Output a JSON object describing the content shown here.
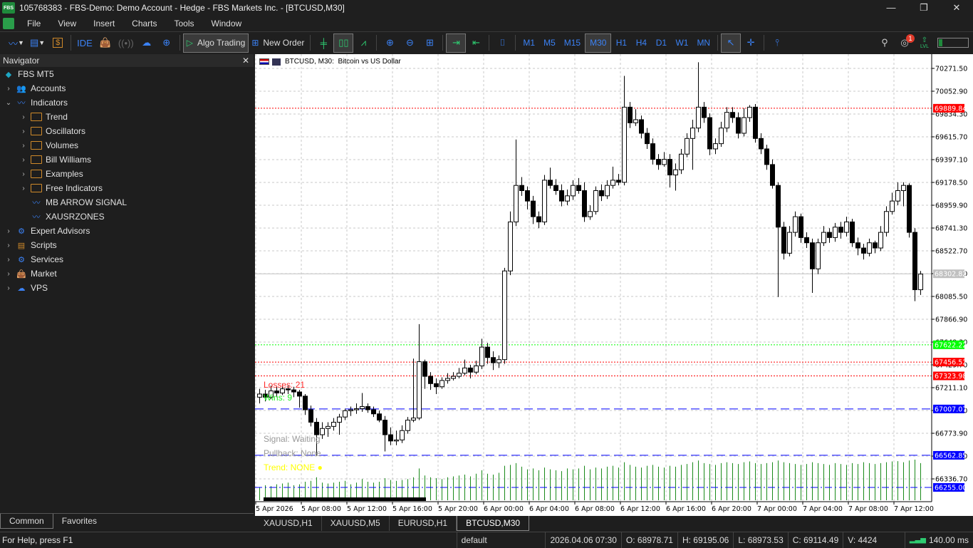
{
  "window": {
    "title": "105768383 - FBS-Demo: Demo Account - Hedge - FBS Markets Inc. - [BTCUSD,M30]",
    "logo_text": "FBS",
    "minimize": "—",
    "restore": "❐",
    "close": "✕"
  },
  "menu": [
    "File",
    "View",
    "Insert",
    "Charts",
    "Tools",
    "Window"
  ],
  "toolbar": {
    "ide": "IDE",
    "algo_trading": "Algo Trading",
    "new_order": "New Order",
    "timeframes": [
      "M1",
      "M5",
      "M15",
      "M30",
      "H1",
      "H4",
      "D1",
      "W1",
      "MN"
    ],
    "selected_timeframe": "M30",
    "notification_count": "1",
    "lvl": "LVL"
  },
  "navigator": {
    "title": "Navigator",
    "close": "✕",
    "root": "FBS MT5",
    "items": [
      {
        "label": "Accounts",
        "level": 0,
        "expander": "›",
        "icon": "accounts-icon"
      },
      {
        "label": "Indicators",
        "level": 0,
        "expander": "⌄",
        "icon": "indicators-icon"
      },
      {
        "label": "Trend",
        "level": 1,
        "expander": "›",
        "icon": "folder-icon"
      },
      {
        "label": "Oscillators",
        "level": 1,
        "expander": "›",
        "icon": "folder-icon"
      },
      {
        "label": "Volumes",
        "level": 1,
        "expander": "›",
        "icon": "folder-icon"
      },
      {
        "label": "Bill Williams",
        "level": 1,
        "expander": "›",
        "icon": "folder-icon"
      },
      {
        "label": "Examples",
        "level": 1,
        "expander": "›",
        "icon": "folder-icon"
      },
      {
        "label": "Free Indicators",
        "level": 1,
        "expander": "›",
        "icon": "folder-icon"
      },
      {
        "label": "MB ARROW SIGNAL",
        "level": 1,
        "expander": "",
        "icon": "indicator-icon"
      },
      {
        "label": "XAUSRZONES",
        "level": 1,
        "expander": "",
        "icon": "indicator-icon"
      },
      {
        "label": "Expert Advisors",
        "level": 0,
        "expander": "›",
        "icon": "experts-icon"
      },
      {
        "label": "Scripts",
        "level": 0,
        "expander": "›",
        "icon": "scripts-icon"
      },
      {
        "label": "Services",
        "level": 0,
        "expander": "›",
        "icon": "services-icon"
      },
      {
        "label": "Market",
        "level": 0,
        "expander": "›",
        "icon": "market-icon"
      },
      {
        "label": "VPS",
        "level": 0,
        "expander": "›",
        "icon": "vps-icon"
      }
    ],
    "tabs": [
      "Common",
      "Favorites"
    ],
    "active_tab": "Common"
  },
  "symbol_tabs": [
    "XAUUSD,H1",
    "XAUUSD,M5",
    "EURUSD,H1",
    "BTCUSD,M30"
  ],
  "active_symbol_tab": "BTCUSD,M30",
  "status": {
    "help": "For Help, press F1",
    "profile": "default",
    "datetime": "2026.04.06 07:30",
    "open": "O: 68978.71",
    "high": "H: 69195.06",
    "low": "L: 68973.53",
    "close": "C: 69114.49",
    "volume": "V: 4424",
    "ping": "140.00 ms"
  },
  "overlay": {
    "losses": "Losses: 21",
    "wins": "Wins: 9",
    "signal": "Signal: Waiting",
    "pullback": "Pullback: None",
    "trend": "Trend: NONE ●"
  },
  "colors": {
    "up": "#ffffff",
    "down": "#000000",
    "volume": "#1a8a1a",
    "losses": "#ff2a2a",
    "wins": "#22ee22",
    "signal": "#999999",
    "trend": "#ffff00",
    "accent": "#3b82f6"
  },
  "chart_data": {
    "type": "candlestick",
    "title": "BTCUSD, M30:  Bitcoin vs US Dollar",
    "symbol": "BTCUSD",
    "timeframe": "M30",
    "ylim": [
      66220,
      70330
    ],
    "y_ticks": [
      "70271.50",
      "70052.90",
      "69834.30",
      "69615.70",
      "69397.10",
      "69178.50",
      "68959.90",
      "68741.30",
      "68522.70",
      "68304.10",
      "68085.50",
      "67866.90",
      "67648.30",
      "67429.70",
      "67211.10",
      "66992.50",
      "66773.90",
      "66555.30",
      "66336.70"
    ],
    "x_labels": [
      "5 Apr 2026",
      "5 Apr 08:00",
      "5 Apr 12:00",
      "5 Apr 16:00",
      "5 Apr 20:00",
      "6 Apr 00:00",
      "6 Apr 04:00",
      "6 Apr 08:00",
      "6 Apr 12:00",
      "6 Apr 16:00",
      "6 Apr 20:00",
      "7 Apr 00:00",
      "7 Apr 04:00",
      "7 Apr 08:00",
      "7 Apr 12:00"
    ],
    "levels": [
      {
        "price": 69889.84,
        "label": "69889.84",
        "color": "#ff0000",
        "style": "dotted"
      },
      {
        "price": 68302.82,
        "label": "68302.82",
        "color": "#c0c0c0",
        "style": "solid"
      },
      {
        "price": 67622.22,
        "label": "67622.22",
        "color": "#00ff00",
        "style": "dotted"
      },
      {
        "price": 67456.52,
        "label": "67456.52",
        "color": "#ff0000",
        "style": "dotted"
      },
      {
        "price": 67323.98,
        "label": "67323.98",
        "color": "#ff0000",
        "style": "dotted"
      },
      {
        "price": 67007.07,
        "label": "67007.07",
        "color": "#0000ff",
        "style": "dashed"
      },
      {
        "price": 66562.85,
        "label": "66562.85",
        "color": "#0000ff",
        "style": "dashed"
      },
      {
        "price": 66255.0,
        "label": "66255.00",
        "color": "#0000ff",
        "style": "dashdot"
      }
    ],
    "candles": [
      [
        67120,
        67200,
        67060,
        67150
      ],
      [
        67150,
        67190,
        67080,
        67120
      ],
      [
        67120,
        67230,
        67100,
        67180
      ],
      [
        67180,
        67220,
        67120,
        67160
      ],
      [
        67160,
        67250,
        67140,
        67200
      ],
      [
        67200,
        67230,
        67150,
        67190
      ],
      [
        67190,
        67220,
        67120,
        67170
      ],
      [
        67170,
        67190,
        67020,
        67130
      ],
      [
        67130,
        67150,
        66950,
        67000
      ],
      [
        67000,
        67040,
        66840,
        66880
      ],
      [
        66880,
        66920,
        66560,
        66760
      ],
      [
        66760,
        66880,
        66720,
        66820
      ],
      [
        66820,
        66880,
        66740,
        66840
      ],
      [
        66840,
        66920,
        66800,
        66880
      ],
      [
        66880,
        66960,
        66760,
        66930
      ],
      [
        66930,
        67010,
        66900,
        66990
      ],
      [
        66990,
        67030,
        66940,
        67000
      ],
      [
        67000,
        67060,
        66960,
        67010
      ],
      [
        67010,
        67160,
        66980,
        67030
      ],
      [
        67030,
        67060,
        66970,
        67000
      ],
      [
        67000,
        67030,
        66930,
        66960
      ],
      [
        66960,
        66990,
        66880,
        66900
      ],
      [
        66900,
        66940,
        66600,
        66760
      ],
      [
        66760,
        66830,
        66660,
        66700
      ],
      [
        66700,
        66800,
        66660,
        66710
      ],
      [
        66710,
        66850,
        66680,
        66800
      ],
      [
        66800,
        66930,
        66770,
        66900
      ],
      [
        66900,
        67490,
        66880,
        66920
      ],
      [
        66920,
        67820,
        66900,
        67460
      ],
      [
        67460,
        67480,
        67200,
        67320
      ],
      [
        67320,
        67360,
        67190,
        67250
      ],
      [
        67250,
        67300,
        67150,
        67220
      ],
      [
        67220,
        67310,
        67200,
        67280
      ],
      [
        67280,
        67350,
        67250,
        67300
      ],
      [
        67300,
        67360,
        67280,
        67320
      ],
      [
        67320,
        67400,
        67300,
        67350
      ],
      [
        67350,
        67480,
        67330,
        67400
      ],
      [
        67400,
        67430,
        67300,
        67360
      ],
      [
        67360,
        67470,
        67340,
        67420
      ],
      [
        67420,
        67680,
        67390,
        67600
      ],
      [
        67600,
        67640,
        67440,
        67500
      ],
      [
        67500,
        67560,
        67380,
        67450
      ],
      [
        67450,
        67520,
        67400,
        67480
      ],
      [
        67480,
        68360,
        67440,
        68330
      ],
      [
        68330,
        68900,
        68290,
        68800
      ],
      [
        68800,
        69590,
        68760,
        69150
      ],
      [
        69150,
        69230,
        69050,
        69100
      ],
      [
        69100,
        69140,
        68920,
        69000
      ],
      [
        69000,
        69050,
        68780,
        68850
      ],
      [
        68850,
        68900,
        68740,
        68800
      ],
      [
        68800,
        69250,
        68770,
        69200
      ],
      [
        69200,
        69320,
        69120,
        69150
      ],
      [
        69150,
        69210,
        69060,
        69100
      ],
      [
        69100,
        69160,
        68950,
        69000
      ],
      [
        69000,
        69110,
        68960,
        69050
      ],
      [
        69050,
        69200,
        69010,
        69150
      ],
      [
        69150,
        69220,
        69070,
        69100
      ],
      [
        69100,
        69180,
        68800,
        68850
      ],
      [
        68850,
        68960,
        68820,
        68900
      ],
      [
        68900,
        69140,
        68870,
        69100
      ],
      [
        69100,
        69160,
        69000,
        69050
      ],
      [
        69050,
        69200,
        69020,
        69150
      ],
      [
        69150,
        69330,
        69120,
        69200
      ],
      [
        69200,
        69260,
        69150,
        69180
      ],
      [
        69180,
        70200,
        69150,
        69900
      ],
      [
        69900,
        69950,
        69700,
        69750
      ],
      [
        69750,
        69880,
        69720,
        69780
      ],
      [
        69780,
        69820,
        69600,
        69650
      ],
      [
        69650,
        69700,
        69500,
        69550
      ],
      [
        69550,
        69600,
        69350,
        69400
      ],
      [
        69400,
        69450,
        69300,
        69350
      ],
      [
        69350,
        69470,
        69330,
        69400
      ],
      [
        69400,
        69450,
        69130,
        69250
      ],
      [
        69250,
        69360,
        69100,
        69300
      ],
      [
        69300,
        69500,
        69260,
        69450
      ],
      [
        69450,
        69650,
        69420,
        69600
      ],
      [
        69600,
        69780,
        69300,
        69700
      ],
      [
        69700,
        70330,
        69660,
        69900
      ],
      [
        69900,
        69950,
        69750,
        69800
      ],
      [
        69800,
        69840,
        69440,
        69500
      ],
      [
        69500,
        69600,
        69450,
        69550
      ],
      [
        69550,
        69760,
        69520,
        69700
      ],
      [
        69700,
        69900,
        69660,
        69850
      ],
      [
        69850,
        69900,
        69750,
        69800
      ],
      [
        69800,
        69850,
        69600,
        69650
      ],
      [
        69650,
        69890,
        69620,
        69800
      ],
      [
        69800,
        69920,
        69760,
        69900
      ],
      [
        69900,
        69930,
        69560,
        69600
      ],
      [
        69600,
        69650,
        69450,
        69500
      ],
      [
        69500,
        69540,
        69300,
        69350
      ],
      [
        69350,
        69400,
        69120,
        69150
      ],
      [
        69150,
        69180,
        68080,
        68750
      ],
      [
        68750,
        68800,
        68440,
        68500
      ],
      [
        68500,
        68760,
        68470,
        68700
      ],
      [
        68700,
        68900,
        68660,
        68850
      ],
      [
        68850,
        68880,
        68600,
        68650
      ],
      [
        68650,
        68700,
        68550,
        68600
      ],
      [
        68600,
        68640,
        68120,
        68350
      ],
      [
        68350,
        68640,
        68300,
        68600
      ],
      [
        68600,
        68760,
        68570,
        68700
      ],
      [
        68700,
        68740,
        68600,
        68650
      ],
      [
        68650,
        68790,
        68610,
        68750
      ],
      [
        68750,
        68800,
        68640,
        68700
      ],
      [
        68700,
        68850,
        68660,
        68800
      ],
      [
        68800,
        68830,
        68560,
        68600
      ],
      [
        68600,
        68650,
        68480,
        68550
      ],
      [
        68550,
        68590,
        68440,
        68500
      ],
      [
        68500,
        68640,
        68470,
        68600
      ],
      [
        68600,
        68620,
        68500,
        68550
      ],
      [
        68550,
        68760,
        68520,
        68700
      ],
      [
        68700,
        68950,
        68660,
        68900
      ],
      [
        68900,
        69080,
        68870,
        69000
      ],
      [
        69000,
        69180,
        68960,
        69100
      ],
      [
        69100,
        69180,
        68950,
        69150
      ],
      [
        69150,
        69170,
        68650,
        68700
      ],
      [
        68700,
        68740,
        68040,
        68150
      ],
      [
        68150,
        68330,
        68100,
        68300
      ]
    ],
    "volume": [
      1500,
      1700,
      1600,
      1800,
      1900,
      2000,
      1700,
      1800,
      2100,
      2200,
      2600,
      2000,
      1900,
      2000,
      2100,
      2200,
      1800,
      2000,
      2400,
      2100,
      2000,
      2100,
      2500,
      2300,
      2200,
      2300,
      2400,
      2600,
      3600,
      2800,
      2600,
      2500,
      2400,
      2600,
      2700,
      2800,
      2900,
      2700,
      3000,
      3400,
      3000,
      2900,
      3100,
      3900,
      4000,
      4200,
      3800,
      3500,
      3600,
      3400,
      3700,
      3500,
      3400,
      3300,
      3600,
      3500,
      3600,
      3900,
      3500,
      3700,
      3600,
      3800,
      3900,
      3700,
      4300,
      4000,
      3800,
      3700,
      3900,
      4000,
      3800,
      3700,
      3900,
      3800,
      4000,
      4100,
      4300,
      4500,
      4200,
      4100,
      4000,
      4200,
      4300,
      4200,
      4100,
      4300,
      4400,
      4200,
      4100,
      4200,
      4300,
      4500,
      4300,
      4200,
      4100,
      4000,
      4100,
      4300,
      4200,
      4100,
      4000,
      4200,
      4100,
      4000,
      4200,
      4100,
      4300,
      4200,
      4100,
      4200,
      4300,
      4400,
      4424,
      4300,
      4500,
      4600,
      4200
    ]
  }
}
